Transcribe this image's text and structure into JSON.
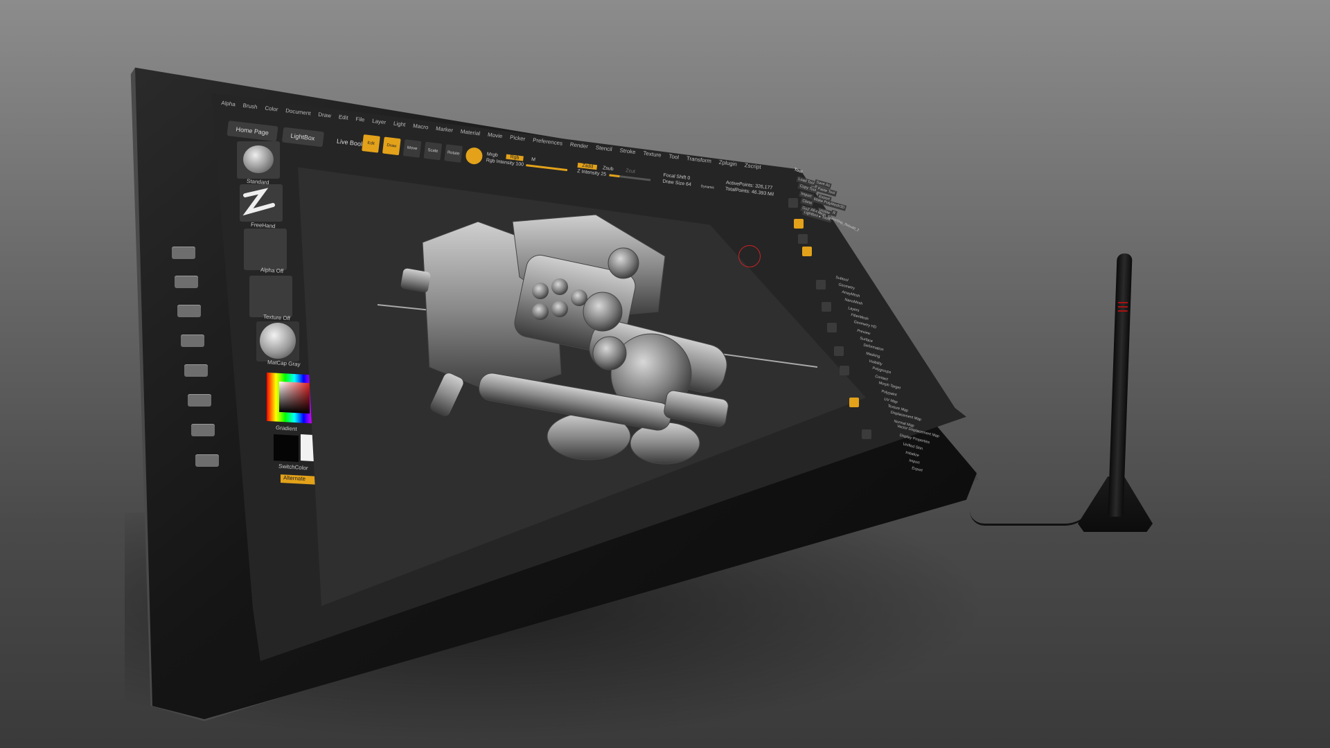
{
  "menubar": [
    "Alpha",
    "Brush",
    "Color",
    "Document",
    "Draw",
    "Edit",
    "File",
    "Layer",
    "Light",
    "Macro",
    "Marker",
    "Material",
    "Movie",
    "Picker",
    "Preferences",
    "Render",
    "Stencil",
    "Stroke",
    "Texture",
    "Tool",
    "Transform",
    "Zplugin",
    "Zscript"
  ],
  "tabs": {
    "home": "Home Page",
    "lightbox": "LightBox",
    "live_boolean": "Live Boolean"
  },
  "toolbar": {
    "edit": "Edit",
    "draw": "Draw",
    "move": "Move",
    "scale": "Scale",
    "rotate": "Rotate",
    "mrgb": "Mrgb",
    "rgb": "Rgb",
    "m": "M",
    "zadd": "Zadd",
    "zsub": "Zsub",
    "zcut": "Zcut",
    "rgb_intensity": "Rgb Intensity 100",
    "z_intensity": "Z Intensity 25",
    "focal_shift": "Focal Shift 0",
    "draw_size": "Draw Size 64",
    "dynamic": "Dynamic",
    "active_points": "ActivePoints: 326,177",
    "total_points": "TotalPoints: 46.393 Mil",
    "rgb_intensity_value": 100,
    "z_intensity_value": 25
  },
  "shelf": {
    "brush": "Standard",
    "stroke": "FreeHand",
    "alpha": "Alpha Off",
    "texture": "Texture Off",
    "material": "MatCap Gray",
    "gradient": "Gradient",
    "switch_color": "SwitchColor",
    "alternate": "Alternate"
  },
  "tool_panel": {
    "title": "Tool",
    "buttons": [
      "Load Tool",
      "Save As",
      "Copy Tool",
      "Paste Tool",
      "Import",
      "Export",
      "Clone",
      "Make PolyMesh3D",
      "GoZ",
      "All",
      "Visible",
      "R",
      "Lightbox ▸ Tools"
    ],
    "current_tool": "4.Mesh_SpaceShip_Rebuild_2",
    "subtools": [
      "Subtool",
      "Geometry",
      "ArrayMesh",
      "NanoMesh",
      "Layers",
      "FiberMesh",
      "Geometry HD",
      "Preview",
      "Surface",
      "Deformation",
      "Masking",
      "Visibility",
      "Polygroups",
      "Contact",
      "Morph Target",
      "Polypaint",
      "UV Map",
      "Texture Map",
      "Displacement Map",
      "Normal Map",
      "Vector Displacement Map",
      "Display Properties",
      "Unified Skin",
      "Initialize",
      "Import",
      "Export"
    ]
  },
  "colors": {
    "accent": "#e3a21a",
    "ui_bg": "#252525",
    "panel": "#3c3c3c"
  }
}
